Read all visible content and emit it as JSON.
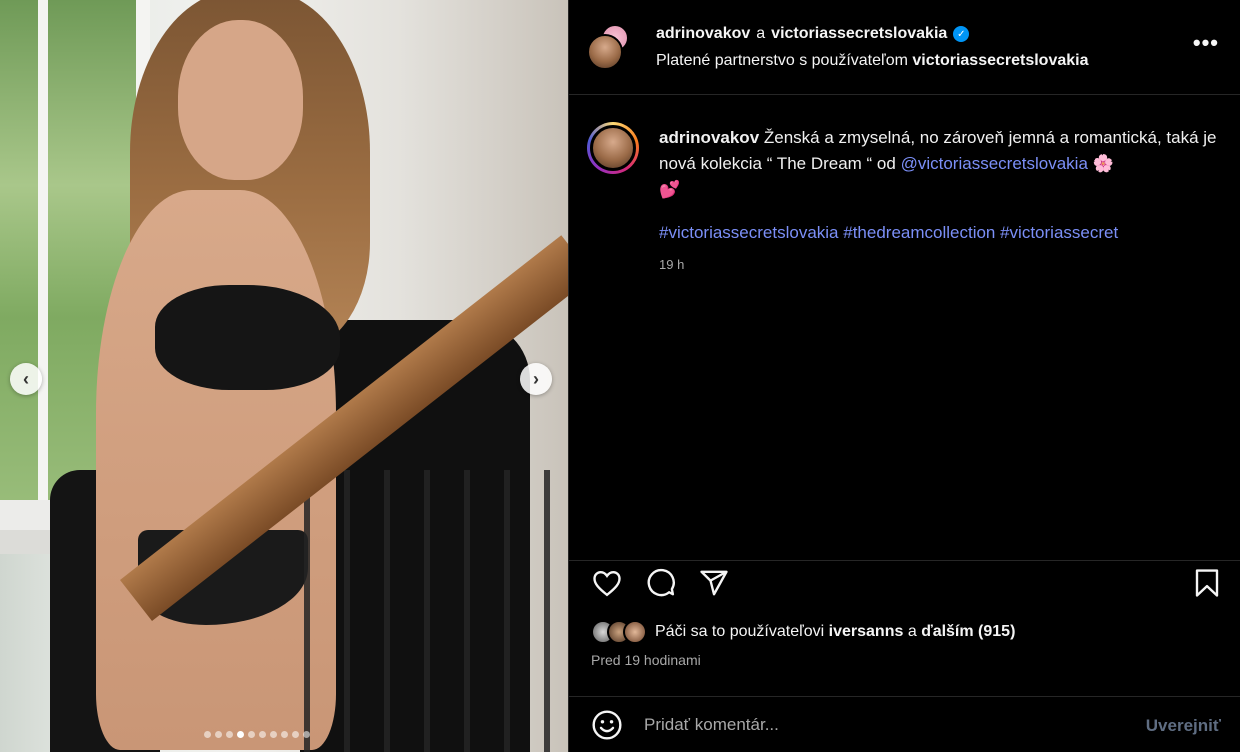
{
  "media": {
    "prev_icon": "chevron-left",
    "next_icon": "chevron-right",
    "dots_count": 10,
    "active_dot": 3
  },
  "header": {
    "author": "adrinovakov",
    "connector": "a",
    "partner": "victoriassecretslovakia",
    "partnership_prefix": "Platené partnerstvo s používateľom",
    "partnership_user": "victoriassecretslovakia",
    "more_label": "•••"
  },
  "caption": {
    "user": "adrinovakov",
    "text_1": "Ženská a zmyselná, no zároveň jemná a romantická, taká je nová kolekcia “ The Dream “ od",
    "mention": "@victoriassecretslovakia",
    "emoji_flower": "🌸",
    "emoji_hearts": "💕",
    "hashtags": "#victoriassecretslovakia #thedreamcollection #victoriassecret",
    "time": "19 h"
  },
  "actions": {
    "like_icon": "heart-outline",
    "comment_icon": "speech-bubble",
    "share_icon": "paper-plane",
    "save_icon": "bookmark"
  },
  "likes": {
    "prefix": "Páči sa to používateľovi",
    "user": "iversanns",
    "connector": "a",
    "others": "ďalším (915)"
  },
  "post_time": "Pred 19 hodinami",
  "comment": {
    "placeholder": "Pridať komentár...",
    "post_label": "Uverejniť"
  },
  "colors": {
    "background": "#000000",
    "link": "#7b8ff7",
    "verified": "#0095f6",
    "muted": "#a8a8a8"
  }
}
